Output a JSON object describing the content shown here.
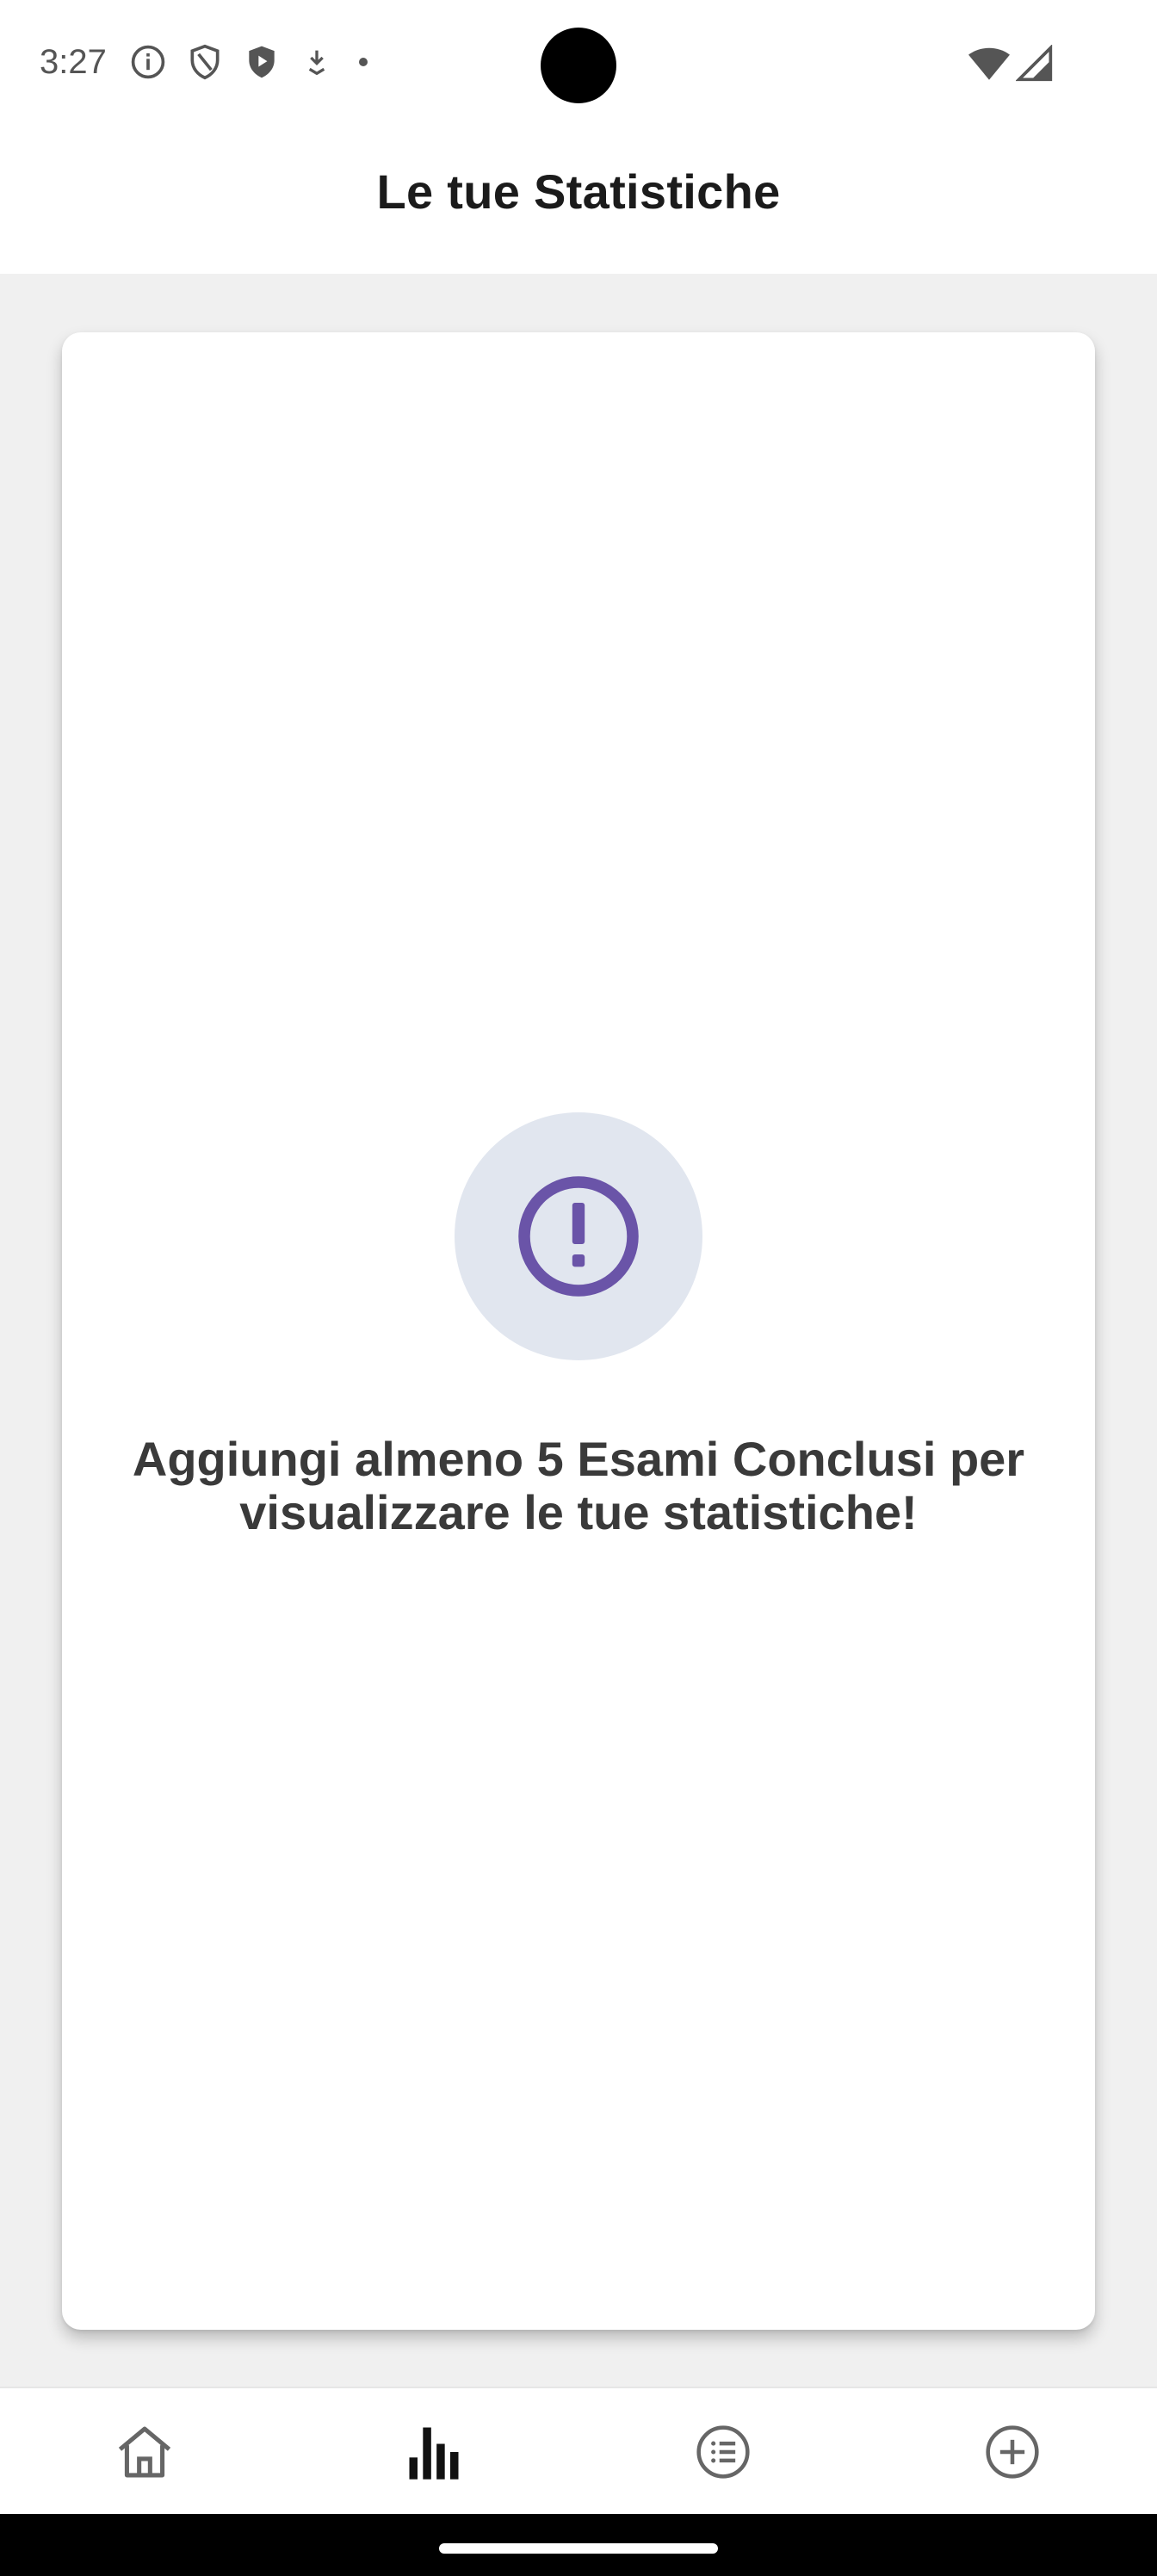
{
  "status_bar": {
    "time": "3:27",
    "icons": [
      "info-icon",
      "shield-outline-icon",
      "play-shield-icon",
      "download-icon",
      "dot-icon",
      "wifi-icon",
      "signal-icon"
    ]
  },
  "header": {
    "title": "Le tue Statistiche"
  },
  "empty_state": {
    "icon": "alert-circle-icon",
    "message": "Aggiungi almeno 5 Esami Conclusi per visualizzare le tue statistiche!",
    "icon_color": "#6a54a8",
    "icon_background": "#e1e6ef"
  },
  "bottom_nav": {
    "items": [
      {
        "icon": "home-icon",
        "selected": false
      },
      {
        "icon": "bar-chart-icon",
        "selected": true
      },
      {
        "icon": "list-icon",
        "selected": false
      },
      {
        "icon": "add-circle-icon",
        "selected": false
      }
    ]
  }
}
